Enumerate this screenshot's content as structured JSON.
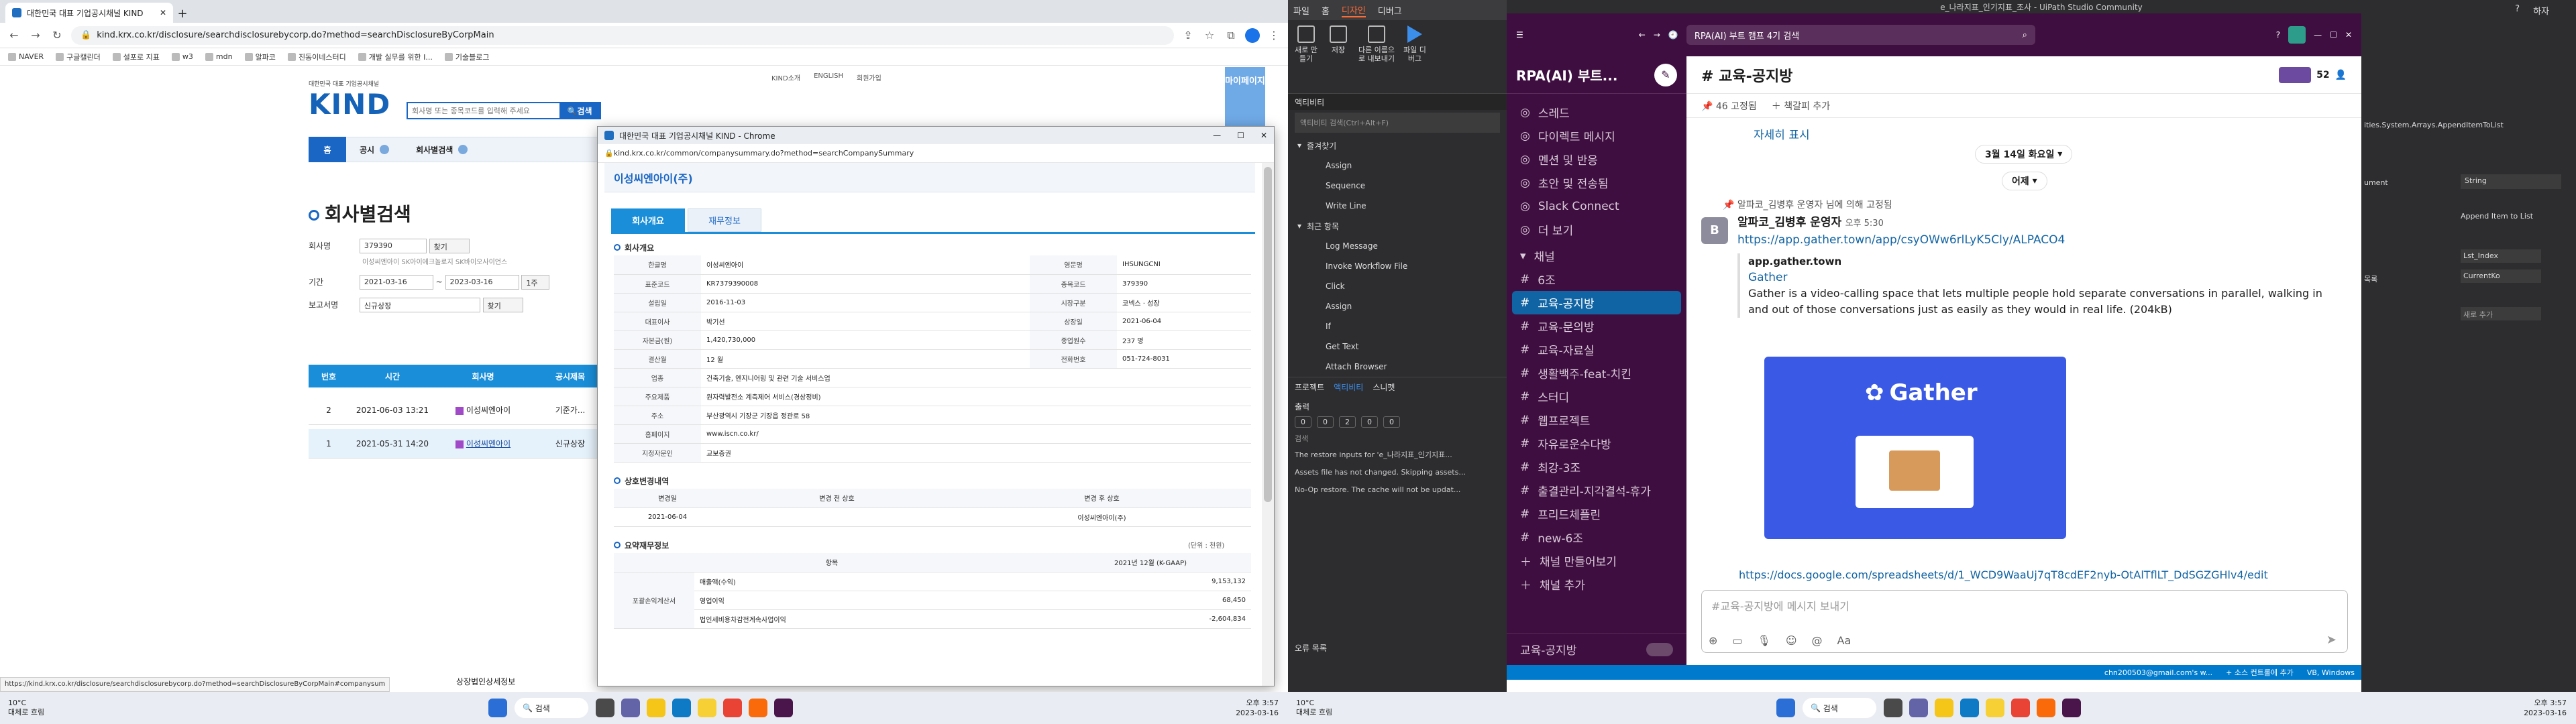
{
  "left": {
    "tab_title": "대한민국 대표 기업공시채널 KIND",
    "url": "kind.krx.co.kr/disclosure/searchdisclosurebycorp.do?method=searchDisclosureByCorpMain",
    "bookmarks": [
      "NAVER",
      "구글캘린더",
      "설포로 지표",
      "w3",
      "mdn",
      "알파코",
      "진동이네스터디",
      "개발 실무를 위한 I...",
      "기술블로그"
    ],
    "kind": {
      "logo": "KIND",
      "logo_sub": "대한민국 대표 기업공시채널",
      "search_placeholder": "회사명 또는 종목코드를 입력해 주세요",
      "search_btn": "검색",
      "toplinks": [
        "KIND소개",
        "ENGLISH",
        "회원가입"
      ],
      "mysvc": "마이페이지",
      "breadcrumb": [
        "홈",
        "공시",
        "회사별검색"
      ],
      "page_title": "회사별검색",
      "form": {
        "company_label": "회사명",
        "company_value": "379390",
        "find_btn": "찾기",
        "period_label": "기간",
        "date_from": "2021-03-16",
        "date_to": "2023-03-16",
        "period_btn": "1주",
        "report_label": "보고서명",
        "report_value": "신규상장",
        "hint": "이성씨엔아이  SK아이에크놀로지  SK바이오사이언스"
      },
      "table_headers": [
        "번호",
        "시간",
        "회사명",
        "공시제목"
      ],
      "rows": [
        {
          "no": "2",
          "time": "2021-06-03 13:21",
          "company": "이성씨엔아이",
          "title": "기준가..."
        },
        {
          "no": "1",
          "time": "2021-05-31 14:20",
          "company": "이성씨엔아이",
          "title": "신규상장"
        }
      ],
      "status_url": "https://kind.krx.co.kr/disclosure/searchdisclosurebycorp.do?method=searchDisclosureByCorpMain#companysum",
      "bottom_text": "상장법인상세정보"
    },
    "popup": {
      "window_title": "대한민국 대표 기업공시채널 KIND - Chrome",
      "url": "kind.krx.co.kr/common/companysummary.do?method=searchCompanySummary",
      "company": "이성씨엔아이(주)",
      "tabs": [
        "회사개요",
        "재무정보"
      ],
      "section1": "회사개요",
      "info": [
        [
          "한글명",
          "이성씨엔아이",
          "영문명",
          "IHSUNGCNI"
        ],
        [
          "표준코드",
          "KR7379390008",
          "종목코드",
          "379390"
        ],
        [
          "설립일",
          "2016-11-03",
          "시장구분",
          "코넥스 · 성장"
        ],
        [
          "대표이사",
          "박기선",
          "상장일",
          "2021-06-04"
        ],
        [
          "자본금(원)",
          "1,420,730,000",
          "종업원수",
          "237 명"
        ],
        [
          "결산월",
          "12 월",
          "전화번호",
          "051-724-8031"
        ],
        [
          "업종",
          "건축기술, 엔지니어링 및 관련 기술 서비스업",
          "",
          ""
        ],
        [
          "주요제품",
          "원자력발전소 계측제어 서비스(경상정비)",
          "",
          ""
        ],
        [
          "주소",
          "부산광역시 기장군 기장읍 정관로 58",
          "",
          ""
        ],
        [
          "홈페이지",
          "www.iscn.co.kr/",
          "",
          ""
        ],
        [
          "지정자문인",
          "교보증권",
          "",
          ""
        ]
      ],
      "section2": "상호변경내역",
      "change_headers": [
        "변경일",
        "변경 전 상호",
        "변경 후 상호"
      ],
      "change_row": [
        "2021-06-04",
        "",
        "이성씨엔아이(주)"
      ],
      "section3": "요약재무정보",
      "unit": "(단위 : 천원)",
      "fin_headers": [
        "항목",
        "2021년 12월 (K-GAAP)"
      ],
      "fin_group": "포괄손익계산서",
      "fin_rows": [
        [
          "매출액(수익)",
          "9,153,132"
        ],
        [
          "영업이익",
          "68,450"
        ],
        [
          "법인세비용차감전계속사업이익",
          "-2,604,834"
        ]
      ]
    },
    "taskbar": {
      "weather": "10°C",
      "weather_sub": "대체로 흐림",
      "search": "검색",
      "time": "오후 3:57",
      "date": "2023-03-16"
    }
  },
  "uipath": {
    "tabs": [
      "파일",
      "홈",
      "디자인",
      "디버그"
    ],
    "ribbon": [
      "새로 만들기",
      "저장",
      "다른 이름으로 내보내기",
      "파일 디버그"
    ],
    "activities_label": "액티비티",
    "search_placeholder": "액티비티 검색(Ctrl+Alt+F)",
    "favorites": "즐겨찾기",
    "fav_items": [
      "Assign",
      "Sequence",
      "Write Line"
    ],
    "recent": "최근 항목",
    "recent_items": [
      "Log Message",
      "Invoke Workflow File",
      "Click",
      "Assign",
      "If",
      "Get Text",
      "Attach Browser"
    ],
    "panel_tabs": [
      "프로젝트",
      "액티비티",
      "스니펫"
    ],
    "output_label": "출력",
    "output_badges": [
      "0",
      "0",
      "2",
      "0",
      "0"
    ],
    "output_search": "검색",
    "output_lines": [
      "The restore inputs for 'e_나라지표_인기지표...",
      "Assets file has not changed. Skipping assets...",
      "No-Op restore. The cache will not be updat..."
    ],
    "errors_label": "오류 목록",
    "right_labels": [
      "ities.System.Arrays.AppendItemToList",
      "ument",
      "String",
      "Append Item to List",
      "Lst_Index",
      "CurrentKo",
      "목록",
      "새로 추가"
    ],
    "window_title": "e_나라지표_인기지표_조사 - UiPath Studio Community",
    "right_menu": [
      "?",
      "하자"
    ]
  },
  "slack": {
    "search": "RPA(AI) 부트 캠프 4기 검색",
    "workspace": "RPA(AI) 부트...",
    "nav": [
      "스레드",
      "다이렉트 메시지",
      "멘션 및 반응",
      "초안 및 전송됨",
      "Slack Connect",
      "더 보기"
    ],
    "channels_label": "채널",
    "channels": [
      "6조",
      "교육-공지방",
      "교육-문의방",
      "교육-자료실",
      "생활백주-feat-치킨",
      "스터디",
      "웹프로젝트",
      "자유로운수다방",
      "최강-3조",
      "출결관리-지각결석-휴가",
      "프리드체플린",
      "new-6조"
    ],
    "active_channel": "교육-공지방",
    "add_channel": "채널 만들어보기",
    "add_channel2": "채널 추가",
    "footer": "교육-공지방",
    "channel_title": "# 교육-공지방",
    "member_count": "52",
    "pinned": "46 고정됨",
    "bookmark": "책갈피 추가",
    "prev_text": "자세히 표시",
    "date1": "3월 14일 화요일",
    "date2": "어제",
    "pin_note": "알파코_김병후 운영자 님에 의해 고정됨",
    "author": "알파코_김병후 운영자",
    "author_time": "오후 5:30",
    "msg_link": "https://app.gather.town/app/csyOWw6rlLyK5Cly/ALPACO4",
    "unfurl_site": "app.gather.town",
    "unfurl_title": "Gather",
    "unfurl_desc": "Gather is a video-calling space that lets multiple people hold separate conversations in parallel, walking in and out of those conversations just as easily as they would in real life. (204kB)",
    "gather_logo": "Gather",
    "doc_link": "https://docs.google.com/spreadsheets/d/1_WCD9WaaUj7qT8cdEF2nyb-OtAlTflLT_DdSGZGHlv4/edit",
    "composer_placeholder": "#교육-공지방에 메시지 보내기",
    "status_bar": [
      "chn200503@gmail.com's w...",
      "+ 소스 컨트롤에 추가",
      "VB, Windows"
    ]
  },
  "right_taskbar": {
    "weather": "10°C",
    "weather_sub": "대체로 흐림",
    "search": "검색",
    "time": "오후 3:57",
    "date": "2023-03-16"
  }
}
